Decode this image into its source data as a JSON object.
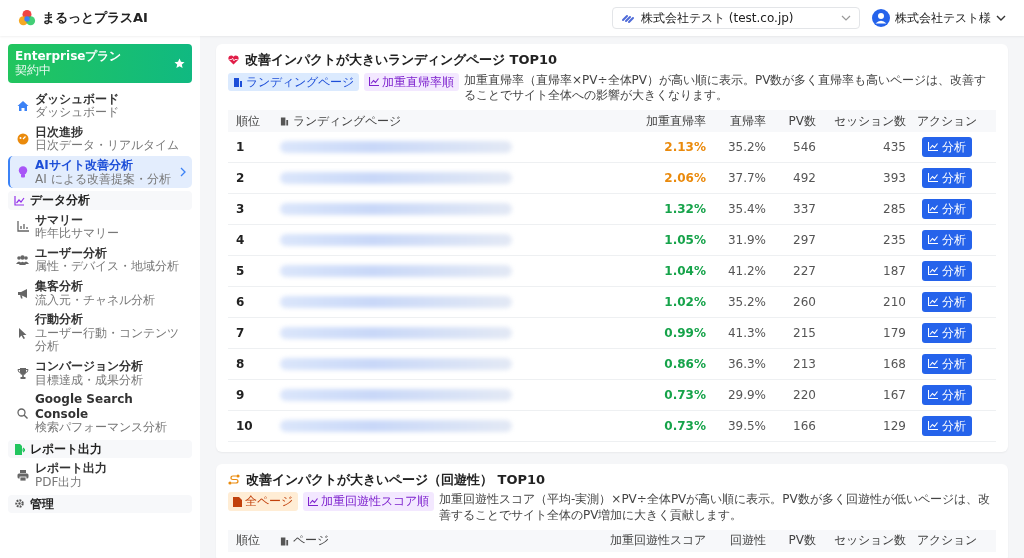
{
  "app": {
    "name": "まるっとプラスAI"
  },
  "header": {
    "site_selector": {
      "value": "株式会社テスト (test.co.jp)"
    },
    "user": {
      "name": "株式会社テスト様"
    }
  },
  "sidebar": {
    "plan": {
      "name": "Enterpriseプラン",
      "status": "契約中"
    },
    "sections": [
      {
        "items": [
          {
            "title": "ダッシュボード",
            "subtitle": "ダッシュボード",
            "selected": false
          },
          {
            "title": "日次進捗",
            "subtitle": "日次データ・リアルタイム",
            "selected": false
          },
          {
            "title": "AIサイト改善分析",
            "subtitle": "AI による改善提案・分析",
            "selected": true
          }
        ]
      },
      {
        "title": "データ分析",
        "items": [
          {
            "title": "サマリー",
            "subtitle": "昨年比サマリー",
            "selected": false
          },
          {
            "title": "ユーザー分析",
            "subtitle": "属性・デバイス・地域分析",
            "selected": false
          },
          {
            "title": "集客分析",
            "subtitle": "流入元・チャネル分析",
            "selected": false
          },
          {
            "title": "行動分析",
            "subtitle": "ユーザー行動・コンテンツ分析",
            "selected": false
          },
          {
            "title": "コンバージョン分析",
            "subtitle": "目標達成・成果分析",
            "selected": false
          },
          {
            "title": "Google Search Console",
            "subtitle": "検索パフォーマンス分析",
            "selected": false
          }
        ]
      },
      {
        "title": "レポート出力",
        "items": [
          {
            "title": "レポート出力",
            "subtitle": "PDF出力",
            "selected": false
          }
        ]
      },
      {
        "title": "管理"
      }
    ]
  },
  "panels": [
    {
      "title": "改善インパクトが大きいランディングページ TOP10",
      "tags": [
        {
          "label": "ランディングページ",
          "color": "#dbeafe"
        },
        {
          "label": "加重直帰率順",
          "color": "#f3e8ff"
        }
      ],
      "description": "加重直帰率（直帰率×PV÷全体PV）が高い順に表示。PV数が多く直帰率も高いページは、改善することでサイト全体への影響が大きくなります。",
      "columns": [
        "順位",
        "ランディングページ",
        "加重直帰率",
        "直帰率",
        "PV数",
        "セッション数",
        "アクション"
      ],
      "rows": [
        {
          "rank": "1",
          "score": "2.13%",
          "color": "#ea8a0c",
          "rate": "35.2%",
          "pv": "546",
          "sessions": "435",
          "action": "分析"
        },
        {
          "rank": "2",
          "score": "2.06%",
          "color": "#ea8a0c",
          "rate": "37.7%",
          "pv": "492",
          "sessions": "393",
          "action": "分析"
        },
        {
          "rank": "3",
          "score": "1.32%",
          "color": "#16a34a",
          "rate": "35.4%",
          "pv": "337",
          "sessions": "285",
          "action": "分析"
        },
        {
          "rank": "4",
          "score": "1.05%",
          "color": "#16a34a",
          "rate": "31.9%",
          "pv": "297",
          "sessions": "235",
          "action": "分析"
        },
        {
          "rank": "5",
          "score": "1.04%",
          "color": "#16a34a",
          "rate": "41.2%",
          "pv": "227",
          "sessions": "187",
          "action": "分析"
        },
        {
          "rank": "6",
          "score": "1.02%",
          "color": "#16a34a",
          "rate": "35.2%",
          "pv": "260",
          "sessions": "210",
          "action": "分析"
        },
        {
          "rank": "7",
          "score": "0.99%",
          "color": "#16a34a",
          "rate": "41.3%",
          "pv": "215",
          "sessions": "179",
          "action": "分析"
        },
        {
          "rank": "8",
          "score": "0.86%",
          "color": "#16a34a",
          "rate": "36.3%",
          "pv": "213",
          "sessions": "168",
          "action": "分析"
        },
        {
          "rank": "9",
          "score": "0.73%",
          "color": "#16a34a",
          "rate": "29.9%",
          "pv": "220",
          "sessions": "167",
          "action": "分析"
        },
        {
          "rank": "10",
          "score": "0.73%",
          "color": "#16a34a",
          "rate": "39.5%",
          "pv": "166",
          "sessions": "129",
          "action": "分析"
        }
      ]
    },
    {
      "title": "改善インパクトが大きいページ（回遊性） TOP10",
      "tags": [
        {
          "label": "全ページ",
          "color": "#ffedd5"
        },
        {
          "label": "加重回遊性スコア順",
          "color": "#f3e8ff"
        }
      ],
      "description": "加重回遊性スコア（平均-実測）×PV÷全体PVが高い順に表示。PV数が多く回遊性が低いページは、改善することでサイト全体のPV増加に大きく貢献します。",
      "columns": [
        "順位",
        "ページ",
        "加重回遊性スコア",
        "回遊性",
        "PV数",
        "セッション数",
        "アクション"
      ]
    }
  ]
}
